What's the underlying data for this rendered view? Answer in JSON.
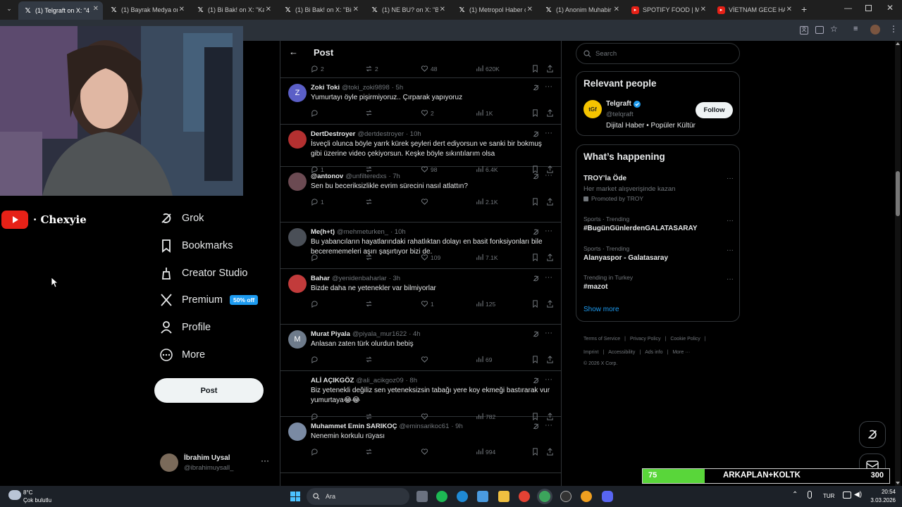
{
  "browser": {
    "tabs": [
      {
        "title": "(1) Telgraft on X: \"4 s",
        "favicon": "x-icon",
        "active": true
      },
      {
        "title": "(1) Bayrak Medya on",
        "favicon": "x-icon"
      },
      {
        "title": "(1) Bi Bak! on X: \"Karo",
        "favicon": "x-icon"
      },
      {
        "title": "(1) Bi Bak! on X: \"Bir g",
        "favicon": "x-icon"
      },
      {
        "title": "(1) NE BU? on X: \"Bir",
        "favicon": "x-icon"
      },
      {
        "title": "(1) Metropol Haber o",
        "favicon": "x-icon"
      },
      {
        "title": "(1) Anonim Muhabir",
        "favicon": "x-icon"
      },
      {
        "title": "SPOTIFY FOOD | Mac",
        "favicon": "youtube-icon"
      },
      {
        "title": "VİETNAM GECE HAYA",
        "favicon": "youtube-icon"
      }
    ]
  },
  "stream": {
    "channel_name": "· Chexyie"
  },
  "sidebar": {
    "items": [
      {
        "label": "Grok",
        "icon": "grok-icon"
      },
      {
        "label": "Bookmarks",
        "icon": "bookmark-icon"
      },
      {
        "label": "Creator Studio",
        "icon": "creator-studio-icon"
      },
      {
        "label": "Premium",
        "icon": "x-logo-icon",
        "badge": "50% off"
      },
      {
        "label": "Profile",
        "icon": "profile-icon"
      },
      {
        "label": "More",
        "icon": "more-circle-icon"
      }
    ],
    "post_button": "Post",
    "account": {
      "name": "İbrahim Uysal",
      "handle": "@ibrahimuysall_"
    }
  },
  "header": {
    "title": "Post"
  },
  "top_stats": {
    "replies": "2",
    "reposts": "2",
    "likes": "48",
    "views": "620K"
  },
  "tweets": [
    {
      "name": "Zoki Toki",
      "handle": "@toki_zoki9898",
      "time": "· 5h",
      "text": "Yumurtayı öyle pişirmiyoruz.. Çırparak yapıyoruz",
      "replies": "",
      "reposts": "",
      "likes": "2",
      "views": "1K",
      "avatar_letter": "Z",
      "avatar_color": "#5b5fc7"
    },
    {
      "name": "DertDestroyer",
      "handle": "@dertdestroyer",
      "time": "· 10h",
      "text": "İsveçli olunca böyle yarrk kürek şeyleri dert ediyorsun ve sanki bir bokmuş gibi üzerine video çekiyorsun. Keşke böyle sıkıntılarım olsa",
      "replies": "1",
      "reposts": "",
      "likes": "98",
      "views": "6.4K",
      "avatar_letter": "",
      "avatar_color": "#b33030"
    },
    {
      "name": "@antonov",
      "handle": "@unfilteredxs",
      "time": "· 7h",
      "text": "Sen bu beceriksizlikle evrim sürecini nasıl atlattın?",
      "replies": "1",
      "reposts": "",
      "likes": "",
      "views": "2.1K",
      "avatar_letter": "",
      "avatar_color": "#6b4a52"
    },
    {
      "name": "Me(h+t)",
      "handle": "@mehmeturken_",
      "time": "· 10h",
      "text": "Bu yabancıların hayatlarındaki rahatlıktan dolayı en basit fonksiyonları bile becerememeleri aşırı şaşırtıyor bizi de.",
      "replies": "",
      "reposts": "",
      "likes": "109",
      "views": "7.1K",
      "avatar_letter": "",
      "avatar_color": "#4a4f57"
    },
    {
      "name": "Bahar",
      "handle": "@yenidenbaharlar",
      "time": "· 3h",
      "text": "Bizde daha ne yetenekler var bilmiyorlar",
      "replies": "",
      "reposts": "",
      "likes": "1",
      "views": "125",
      "avatar_letter": "",
      "avatar_color": "#c23b3b"
    },
    {
      "name": "Murat Piyala",
      "handle": "@piyala_mur1622",
      "time": "· 4h",
      "text": "Anlasan zaten türk olurdun bebiş",
      "replies": "",
      "reposts": "",
      "likes": "",
      "views": "69",
      "avatar_letter": "M",
      "avatar_color": "#6e7b8b"
    },
    {
      "name": "ALİ AÇIKGÖZ",
      "handle": "@ali_acikgoz09",
      "time": "· 8h",
      "text": "Biz yetenekli değiliz  sen yeteneksizsin tabağı yere koy ekmeği bastırarak vur yumurtaya😂😂",
      "replies": "",
      "reposts": "",
      "likes": "",
      "views": "782",
      "avatar_letter": "",
      "avatar_color": "#000000"
    },
    {
      "name": "Muhammet Emin SARIKOÇ",
      "handle": "@eminsarikoc61",
      "time": "· 9h",
      "text": "Nenemin korkulu rüyası",
      "replies": "",
      "reposts": "",
      "likes": "",
      "views": "994",
      "avatar_letter": "",
      "avatar_color": "#7a8aa3"
    }
  ],
  "right": {
    "search_placeholder": "Search",
    "relevant_title": "Relevant people",
    "relevant": {
      "name": "Telgraft",
      "handle": "@telqraft",
      "bio": "Dijital Haber • Popüler Kültür",
      "follow": "Follow"
    },
    "happening_title": "What’s happening",
    "trends": [
      {
        "title": "TROY’la Öde",
        "sub": "Her market alışverişinde kazan",
        "promo": "Promoted by TROY"
      },
      {
        "meta": "Sports · Trending",
        "title": "#BugünGünlerdenGALATASARAY"
      },
      {
        "meta": "Sports · Trending",
        "title": "Alanyaspor - Galatasaray"
      },
      {
        "meta": "Trending in Turkey",
        "title": "#mazot"
      }
    ],
    "show_more": "Show more",
    "footer": [
      "Terms of Service",
      "|",
      "Privacy Policy",
      "|",
      "Cookie Policy",
      "|",
      "Imprint",
      "|",
      "Accessibility",
      "|",
      "Ads info",
      "|",
      "More ···"
    ],
    "copyright": "© 2026 X Corp."
  },
  "overlay": {
    "left_value": "75",
    "label": "ARKAPLAN+KOLTK",
    "right_value": "300",
    "progress_fraction": 0.25
  },
  "taskbar": {
    "weather_temp": "8°C",
    "weather_desc": "Çok bulutlu",
    "search_placeholder": "Ara",
    "lang": "TUR",
    "time": "20:54",
    "date": "3.03.2026"
  },
  "colors": {
    "accent": "#1d9bf0",
    "premium_badge": "#1d9bf0",
    "overlay_green": "#59d63a",
    "background": "#000000"
  }
}
